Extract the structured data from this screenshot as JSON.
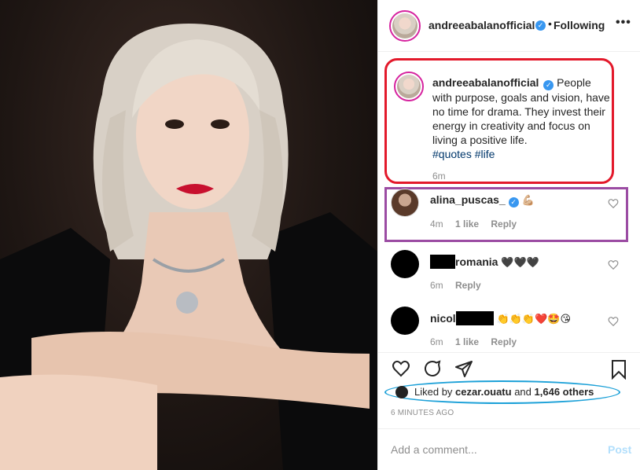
{
  "post": {
    "author": "andreeabalanofficial",
    "follow_separator": "•",
    "follow_label": "Following",
    "more_label": "•••"
  },
  "caption": {
    "username": "andreeabalanofficial",
    "text": "People with purpose, goals and vision, have no time for drama. They invest their energy in creativity and focus on living a positive life.",
    "hashtags": [
      "#quotes",
      "#life"
    ],
    "time": "6m"
  },
  "comments": [
    {
      "username": "alina_puscas_",
      "verified": true,
      "text": "💪🏼",
      "time": "4m",
      "likes": "1 like",
      "reply": "Reply"
    },
    {
      "username_suffix": "romania",
      "text": "🖤🖤🖤",
      "time": "6m",
      "reply": "Reply"
    },
    {
      "username_prefix": "nicol",
      "text": "👏👏👏❤️🤩😘",
      "time": "6m",
      "likes": "1 like",
      "reply": "Reply"
    }
  ],
  "likes": {
    "prefix": "Liked by",
    "user": "cezar.ouatu",
    "joiner": "and",
    "others": "1,646 others"
  },
  "timestamp": "6 MINUTES AGO",
  "add_comment": {
    "placeholder": "Add a comment...",
    "post_label": "Post"
  },
  "colors": {
    "caption_highlight": "#e3192b",
    "comment_highlight": "#9b4ca3",
    "likes_highlight": "#1da1d8",
    "verified": "#3897f0",
    "hashtag": "#00376b"
  }
}
